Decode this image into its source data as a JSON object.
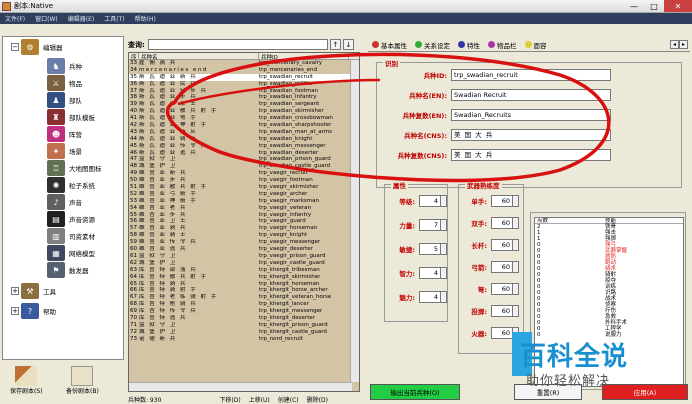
{
  "window": {
    "title": "剧本:Native",
    "minimize": "—",
    "maximize": "□",
    "close": "✕"
  },
  "menu": [
    "文件(F)",
    "窗口(W)",
    "编辑器(E)",
    "工具(T)",
    "帮助(H)"
  ],
  "tree": {
    "root": "编辑器",
    "items": [
      "兵种",
      "物品",
      "部队",
      "部队模板",
      "阵营",
      "场景",
      "大地图图标",
      "粒子系统",
      "声音",
      "声音资源",
      "司资素材",
      "网络模型",
      "触发器"
    ],
    "tools": "工具",
    "help": "帮助"
  },
  "bottom_tools": {
    "save": "保存剧本(S)",
    "backup": "备份剧本(B)"
  },
  "query": {
    "label": "查询:",
    "value": "",
    "up": "↑",
    "down": "↓"
  },
  "list": {
    "headers": [
      "序",
      "兵种名",
      "兵种ID"
    ],
    "rows": [
      [
        "33",
        "雇 佣 骑 兵",
        "trp_mercenary_cavalry"
      ],
      [
        "34",
        "mercenaries end",
        "trp_mercenaries_end"
      ],
      [
        "35",
        "斯 瓦 迪 亚 新 兵",
        "trp_swadian_recruit"
      ],
      [
        "36",
        "斯 瓦 迪 亚 民 兵",
        "trp_swadian_militia"
      ],
      [
        "37",
        "斯 瓦 迪 亚 轻 步 兵",
        "trp_swadian_footman"
      ],
      [
        "38",
        "斯 瓦 迪 亚 步 兵",
        "trp_swadian_infantry"
      ],
      [
        "39",
        "斯 瓦 迪 亚 军 士",
        "trp_swadian_sergeant"
      ],
      [
        "40",
        "斯 瓦 迪 亚 散 兵 射 手",
        "trp_swadian_skirmisher"
      ],
      [
        "41",
        "斯 瓦 迪 亚 弩 手",
        "trp_swadian_crossbowman"
      ],
      [
        "42",
        "斯 瓦 迪 亚 神 射 手",
        "trp_swadian_sharpshooter"
      ],
      [
        "43",
        "斯 瓦 迪 亚 侍 从",
        "trp_swadian_man_at_arms"
      ],
      [
        "44",
        "斯 瓦 迪 亚 骑 士",
        "trp_swadian_knight"
      ],
      [
        "45",
        "斯 瓦 迪 亚 传 令 兵",
        "trp_swadian_messenger"
      ],
      [
        "46",
        "斯 瓦 迪 亚 逃 兵",
        "trp_swadian_deserter"
      ],
      [
        "47",
        "监 狱 守 卫",
        "trp_swadian_prison_guard"
      ],
      [
        "48",
        "城 堡 护 卫",
        "trp_swadian_castle_guard"
      ],
      [
        "49",
        "维 吉 亚 新 兵",
        "trp_vaegir_recruit"
      ],
      [
        "50",
        "维 吉 亚 步 兵",
        "trp_vaegir_footman"
      ],
      [
        "51",
        "维 吉 亚 散 兵 射 手",
        "trp_vaegir_skirmisher"
      ],
      [
        "52",
        "维 吉 亚 弓 箭 手",
        "trp_vaegir_archer"
      ],
      [
        "53",
        "维 吉 亚 神 箭 手",
        "trp_vaegir_marksman"
      ],
      [
        "54",
        "维 吉 亚 老 兵",
        "trp_vaegir_veteran"
      ],
      [
        "55",
        "维 吉 亚 步 兵",
        "trp_vaegir_infantry"
      ],
      [
        "56",
        "维 吉 亚 卫 士",
        "trp_vaegir_guard"
      ],
      [
        "57",
        "维 吉 亚 骑 兵",
        "trp_vaegir_horseman"
      ],
      [
        "58",
        "维 吉 亚 骑 士",
        "trp_vaegir_knight"
      ],
      [
        "59",
        "维 吉 亚 传 令 兵",
        "trp_vaegir_messenger"
      ],
      [
        "60",
        "维 吉 亚 逃 兵",
        "trp_vaegir_deserter"
      ],
      [
        "61",
        "监 狱 守 卫",
        "trp_vaegir_prison_guard"
      ],
      [
        "62",
        "城 堡 护 卫",
        "trp_vaegir_castle_guard"
      ],
      [
        "63",
        "库 吉 特 部 落 兵",
        "trp_khergit_tribesman"
      ],
      [
        "64",
        "库 吉 特 散 兵 射 手",
        "trp_khergit_skirmisher"
      ],
      [
        "65",
        "库 吉 特 骑 兵",
        "trp_khergit_horseman"
      ],
      [
        "66",
        "库 吉 特 骑 射 手",
        "trp_khergit_horse_archer"
      ],
      [
        "67",
        "库 吉 特 老 练 骑 射 手",
        "trp_khergit_veteran_horse"
      ],
      [
        "68",
        "库 吉 特 枪 骑 兵",
        "trp_khergit_lancer"
      ],
      [
        "69",
        "库 吉 特 传 令 兵",
        "trp_khergit_messenger"
      ],
      [
        "70",
        "库 吉 特 逃 兵",
        "trp_khergit_deserter"
      ],
      [
        "71",
        "监 狱 守 卫",
        "trp_khergit_prison_guard"
      ],
      [
        "72",
        "城 堡 护 卫",
        "trp_khergit_castle_guard"
      ],
      [
        "73",
        "诺 德 新 兵",
        "trp_nord_recruit"
      ]
    ]
  },
  "status": {
    "count": "兵种数: 930",
    "down": "下移(D)",
    "up": "上移(U)",
    "create": "创建(C)",
    "delete": "删除(D)"
  },
  "tabs": [
    "基本属性",
    "关系设定",
    "特性",
    "物品栏",
    "面容"
  ],
  "identity": {
    "title": "识别",
    "id_label": "兵种ID:",
    "id_value": "trp_swadian_recruit",
    "name_label": "兵种名(EN):",
    "name_value": "Swadian Recruit",
    "plural_label": "兵种复数(EN):",
    "plural_value": "Swadian_Recruits",
    "cn_name_label": "兵种名(CNS):",
    "cn_name_value": "美 国 大 兵",
    "cn_plural_label": "兵种复数(CNS):",
    "cn_plural_value": "美 国 大 兵"
  },
  "attributes": {
    "title": "属性",
    "rows": [
      [
        "等级:",
        "4"
      ],
      [
        "力量:",
        "7"
      ],
      [
        "敏捷:",
        "5"
      ],
      [
        "智力:",
        "4"
      ],
      [
        "魅力:",
        "4"
      ]
    ]
  },
  "weapons": {
    "title": "武器熟练度",
    "rows": [
      [
        "单手:",
        "60"
      ],
      [
        "双手:",
        "60"
      ],
      [
        "长杆:",
        "60"
      ],
      [
        "弓箭:",
        "60"
      ],
      [
        "弩:",
        "60"
      ],
      [
        "投掷:",
        "60"
      ],
      [
        "火器:",
        "60"
      ]
    ]
  },
  "points": {
    "headers": [
      "点数",
      "技能"
    ],
    "rows": [
      [
        "2",
        "铁骨"
      ],
      [
        "1",
        "强击"
      ],
      [
        "1",
        "强掷"
      ],
      [
        "0",
        "强弓"
      ],
      [
        "0",
        "武器掌握"
      ],
      [
        "0",
        "盾防"
      ],
      [
        "0",
        "跑动"
      ],
      [
        "0",
        "骑术"
      ],
      [
        "0",
        "骑射"
      ],
      [
        "0",
        "掠夺"
      ],
      [
        "0",
        "训练"
      ],
      [
        "0",
        "识路"
      ],
      [
        "0",
        "战术"
      ],
      [
        "0",
        "侦察"
      ],
      [
        "0",
        "疗伤"
      ],
      [
        "0",
        "急救"
      ],
      [
        "0",
        "外科手术"
      ],
      [
        "0",
        "工程学"
      ],
      [
        "0",
        "说服力"
      ]
    ]
  },
  "buttons": {
    "export": "输出当前兵种(O)",
    "reset": "重置(R)",
    "apply": "应用(A)"
  },
  "watermark": {
    "main": "百科全说",
    "sub": "助你轻松解决"
  },
  "colors": {
    "red_loop": "#d81010",
    "export_bg": "#22cc44",
    "apply_bg": "#e02020",
    "list_bg": "#d4c4a6"
  }
}
